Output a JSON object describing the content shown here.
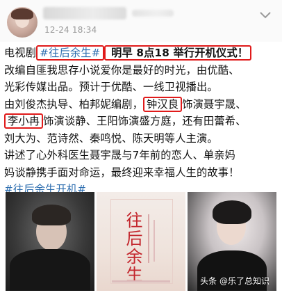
{
  "post": {
    "time": "12-24 18:34",
    "lines": [
      {
        "parts": [
          {
            "t": "电视剧",
            "k": "plain"
          },
          {
            "t": "#往后余生#",
            "k": "tag-box"
          },
          {
            "t": " 明早 8点18 举行开机仪式！",
            "k": "box-bold"
          }
        ]
      },
      {
        "parts": [
          {
            "t": "改编自匪我思存小说爱你是最好的时光，由优酷、",
            "k": "plain"
          }
        ]
      },
      {
        "parts": [
          {
            "t": "光彩传媒出品。预计于优酷、一线卫视播出。",
            "k": "plain"
          }
        ]
      },
      {
        "parts": [
          {
            "t": "由刘俊杰执导、柏邦妮编剧，",
            "k": "plain"
          },
          {
            "t": "钟汉良",
            "k": "box"
          },
          {
            "t": "饰演聂宇晟、",
            "k": "plain"
          }
        ]
      },
      {
        "parts": [
          {
            "t": "李小冉",
            "k": "box"
          },
          {
            "t": "饰演谈静、王阳饰演盛方庭，还有田蕾希、",
            "k": "plain"
          }
        ]
      },
      {
        "parts": [
          {
            "t": "刘大为、范诗然、秦鸣悦、陈天明等人主演。",
            "k": "plain"
          }
        ]
      },
      {
        "parts": [
          {
            "t": "讲述了心外科医生聂宇晟与7年前的恋人、单亲妈",
            "k": "plain"
          }
        ]
      },
      {
        "parts": [
          {
            "t": "妈谈静携手面对命运，最终迎来幸福人生的故事！",
            "k": "plain"
          }
        ]
      },
      {
        "parts": [
          {
            "t": "#往后余生开机#",
            "k": "tag"
          }
        ]
      }
    ]
  },
  "images": {
    "poster_title": "往后余生",
    "watermark": "头条 @乐了总知识"
  },
  "colors": {
    "hashtag": "#2f6fb0",
    "highlight_box": "#e01a1a"
  }
}
